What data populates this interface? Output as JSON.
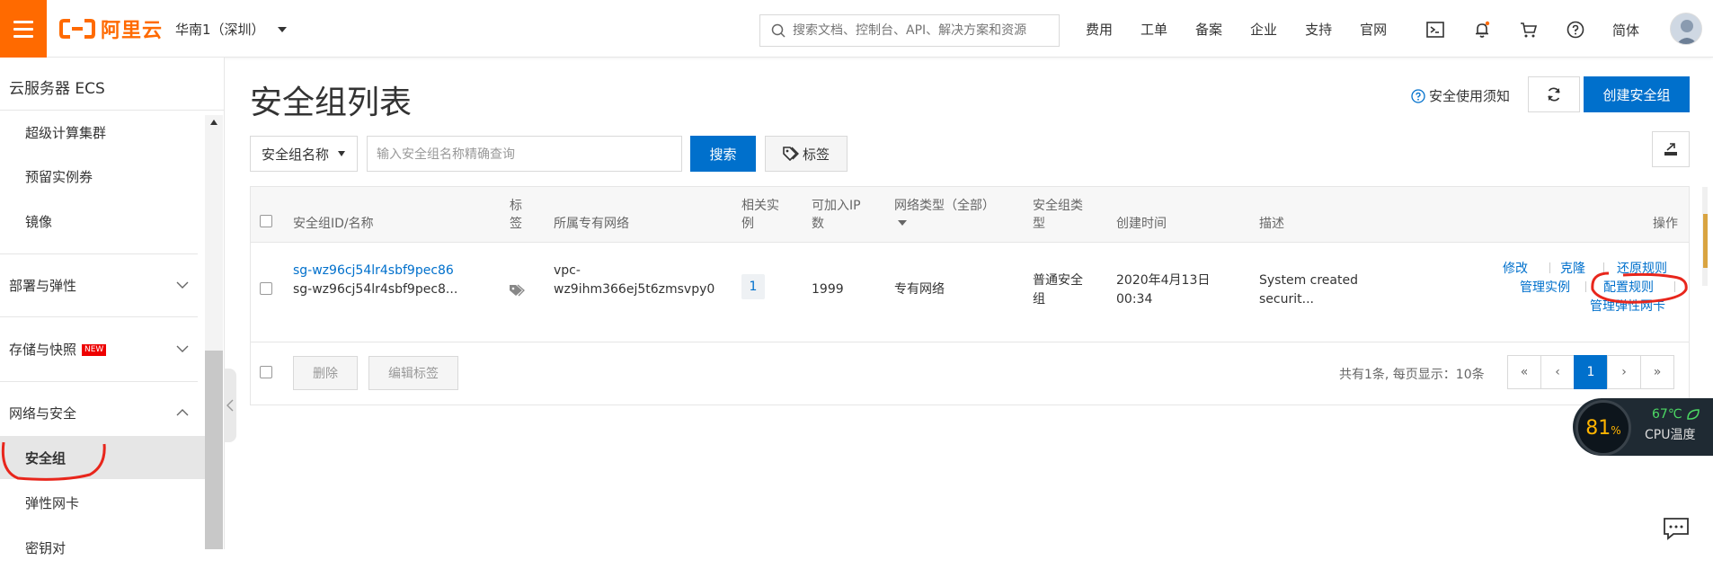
{
  "header": {
    "logo_text": "阿里云",
    "region": "华南1（深圳）",
    "search_placeholder": "搜索文档、控制台、API、解决方案和资源",
    "nav": [
      "费用",
      "工单",
      "备案",
      "企业",
      "支持",
      "官网"
    ],
    "lang": "简体",
    "icons": [
      "terminal-icon",
      "bell-icon",
      "cart-icon",
      "help-icon"
    ]
  },
  "sidebar": {
    "title": "云服务器 ECS",
    "items_top": [
      "超级计算集群",
      "预留实例券",
      "镜像"
    ],
    "group_deploy": "部署与弹性",
    "group_storage": "存储与快照",
    "new_badge": "NEW",
    "group_network": "网络与安全",
    "items_network": [
      "安全组",
      "弹性网卡",
      "密钥对"
    ]
  },
  "page": {
    "title": "安全组列表",
    "notice": "安全使用须知",
    "create_button": "创建安全组"
  },
  "filter": {
    "select_value": "安全组名称",
    "input_placeholder": "输入安全组名称精确查询",
    "search_button": "搜索",
    "tag_button": "标签"
  },
  "table": {
    "headers": {
      "id_name": "安全组ID/名称",
      "tag_line1": "标",
      "tag_line2": "签",
      "vpc": "所属专有网络",
      "related_line1": "相关实",
      "related_line2": "例",
      "ip_line1": "可加入IP",
      "ip_line2": "数",
      "net_type": "网络类型（全部）",
      "sg_type_line1": "安全组类",
      "sg_type_line2": "型",
      "created": "创建时间",
      "desc": "描述",
      "ops": "操作"
    },
    "row": {
      "id": "sg-wz96cj54lr4sbf9pec86",
      "name": "sg-wz96cj54lr4sbf9pec8...",
      "vpc_line1": "vpc-",
      "vpc_line2": "wz9ihm366ej5t6zmsvpy0",
      "related": "1",
      "ip_count": "1999",
      "net_type": "专有网络",
      "sg_type_line1": "普通安全",
      "sg_type_line2": "组",
      "created_line1": "2020年4月13日",
      "created_line2": "00:34",
      "desc_line1": "System created",
      "desc_line2": "securit...",
      "op_modify": "修改",
      "op_clone": "克隆",
      "op_restore": "还原规则",
      "op_manage": "管理实例",
      "op_config": "配置规则",
      "op_eni": "管理弹性网卡"
    },
    "footer": {
      "delete_button": "删除",
      "edit_tags_button": "编辑标签",
      "pager_info": "共有1条, 每页显示：10条",
      "pages": [
        "«",
        "‹",
        "1",
        "›",
        "»"
      ]
    }
  },
  "widget": {
    "cpu_percent": "81",
    "cpu_percent_unit": "%",
    "cpu_temp": "67℃",
    "cpu_label": "CPU温度"
  },
  "colors": {
    "brand": "#ff6a00",
    "primary": "#0070cc",
    "annotation": "#e8261c"
  }
}
